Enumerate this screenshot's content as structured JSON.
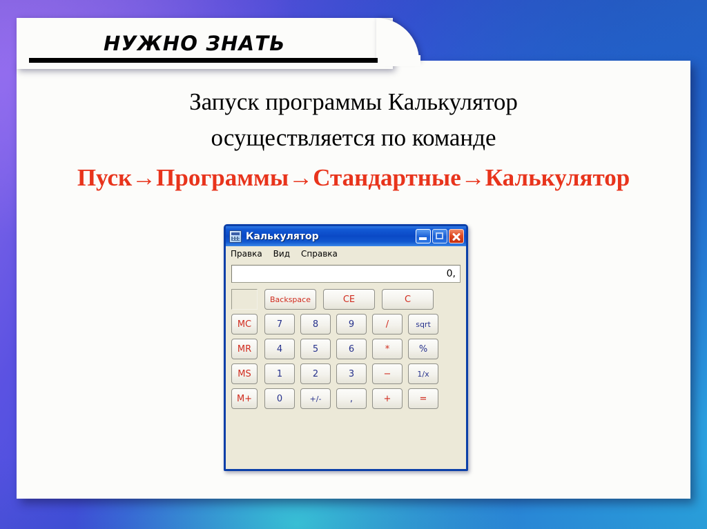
{
  "slide": {
    "heading": "НУЖНО ЗНАТЬ",
    "body_line_1": "Запуск программы Калькулятор",
    "body_line_2": "осуществляется по команде",
    "body_line_3": "Пуск→Программы→Стандартные→Калькулятор",
    "accent_red": "#e8341c",
    "heading_color": "#050505"
  },
  "calculator": {
    "title": "Калькулятор",
    "icon": "calculator-icon",
    "window_buttons": {
      "minimize": "minimize-icon",
      "maximize": "maximize-icon",
      "close": "close-icon"
    },
    "menu": [
      "Правка",
      "Вид",
      "Справка"
    ],
    "display_value": "0,",
    "memory_indicator": "",
    "top_row": [
      {
        "label": "Backspace",
        "color": "red"
      },
      {
        "label": "CE",
        "color": "red"
      },
      {
        "label": "C",
        "color": "red"
      }
    ],
    "rows": [
      [
        {
          "label": "MC",
          "color": "red"
        },
        {
          "label": "7",
          "color": "blue"
        },
        {
          "label": "8",
          "color": "blue"
        },
        {
          "label": "9",
          "color": "blue"
        },
        {
          "label": "/",
          "color": "red"
        },
        {
          "label": "sqrt",
          "color": "blue"
        }
      ],
      [
        {
          "label": "MR",
          "color": "red"
        },
        {
          "label": "4",
          "color": "blue"
        },
        {
          "label": "5",
          "color": "blue"
        },
        {
          "label": "6",
          "color": "blue"
        },
        {
          "label": "*",
          "color": "red"
        },
        {
          "label": "%",
          "color": "blue"
        }
      ],
      [
        {
          "label": "MS",
          "color": "red"
        },
        {
          "label": "1",
          "color": "blue"
        },
        {
          "label": "2",
          "color": "blue"
        },
        {
          "label": "3",
          "color": "blue"
        },
        {
          "label": "−",
          "color": "red"
        },
        {
          "label": "1/x",
          "color": "blue"
        }
      ],
      [
        {
          "label": "M+",
          "color": "red"
        },
        {
          "label": "0",
          "color": "blue"
        },
        {
          "label": "+/-",
          "color": "blue"
        },
        {
          "label": ",",
          "color": "blue"
        },
        {
          "label": "+",
          "color": "red"
        },
        {
          "label": "=",
          "color": "red"
        }
      ]
    ]
  }
}
